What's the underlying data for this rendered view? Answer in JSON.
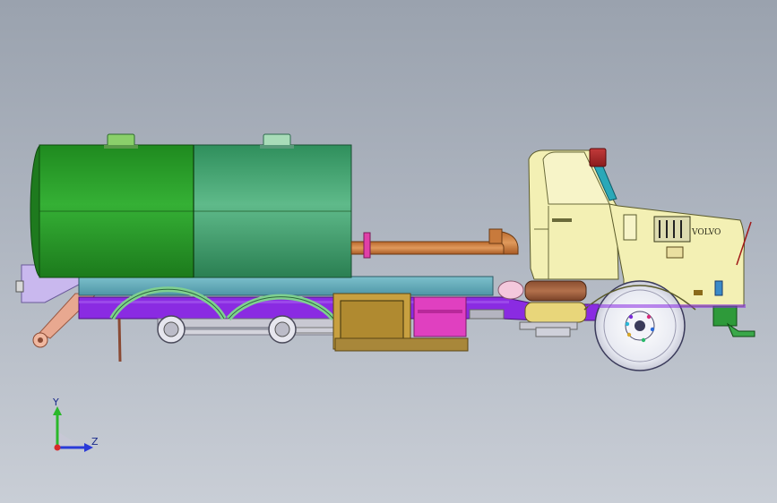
{
  "viewport": {
    "background_top": "#9aa2ae",
    "background_bottom": "#c9ced6"
  },
  "model": {
    "cab_badge": "VOLVO",
    "tank_front_color": "#2e9a2e",
    "tank_rear_color": "#3d9a6a",
    "cab_color": "#f3f0b4",
    "chassis_color": "#8a2be2",
    "subframe_color": "#5fa8b8",
    "pipe_color": "#c87a3c"
  },
  "triad": {
    "y_label": "Y",
    "z_label": "Z",
    "icons": [
      "y-axis-arrow-icon",
      "z-axis-arrow-icon",
      "origin-icon"
    ]
  }
}
